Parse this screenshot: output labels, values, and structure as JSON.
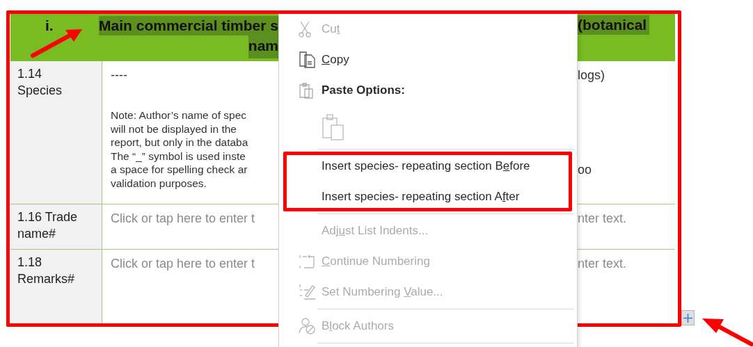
{
  "table": {
    "header": {
      "number": "i.",
      "title_line_1": "Main commercial timber s",
      "title_line_2": "nam",
      "title_right": "(botanical"
    },
    "rows": [
      {
        "label": "1.14\nSpecies",
        "left_top": "----",
        "left_note": "Note: Author’s name of spec\nwill not be displayed in the\nreport, but only in the databa\nThe “_” symbol is used inste\na space for spelling check ar\nvalidation purposes.",
        "right_top": "logs)",
        "right_bottom": "oo",
        "placeholder": false
      },
      {
        "label": "1.16 Trade\nname#",
        "left_top": "Click or tap here to enter t",
        "right_top": "nter text.",
        "placeholder": true
      },
      {
        "label": "1.18\nRemarks#",
        "left_top": "Click or tap here to enter t",
        "right_top": "nter text.",
        "placeholder": true
      }
    ]
  },
  "context_menu": {
    "items": [
      {
        "kind": "command",
        "label": {
          "before": "Cu",
          "key": "t"
        },
        "disabled": true
      },
      {
        "kind": "command",
        "label": {
          "key": "C",
          "after": "opy"
        },
        "disabled": false
      },
      {
        "kind": "heading",
        "label": {
          "before": "Paste Options:"
        },
        "disabled": false
      },
      {
        "kind": "paste-option",
        "disabled": true
      },
      {
        "kind": "separator"
      },
      {
        "kind": "command",
        "label": {
          "before": "Insert species- repeating section B",
          "key": "e",
          "after": "fore"
        },
        "disabled": false
      },
      {
        "kind": "command",
        "label": {
          "before": "Insert species- repeating section A",
          "key": "f",
          "after": "ter"
        },
        "disabled": false
      },
      {
        "kind": "separator"
      },
      {
        "kind": "command",
        "label": {
          "before": "Adj",
          "key": "u",
          "after": "st List Indents..."
        },
        "disabled": true
      },
      {
        "kind": "command",
        "label": {
          "key": "C",
          "after": "ontinue Numbering"
        },
        "disabled": true
      },
      {
        "kind": "command",
        "label": {
          "before": "Set Numbering ",
          "key": "V",
          "after": "alue..."
        },
        "disabled": true
      },
      {
        "kind": "separator"
      },
      {
        "kind": "command",
        "label": {
          "before": "B",
          "key": "l",
          "after": "ock Authors"
        },
        "disabled": true
      },
      {
        "kind": "separator"
      }
    ]
  }
}
